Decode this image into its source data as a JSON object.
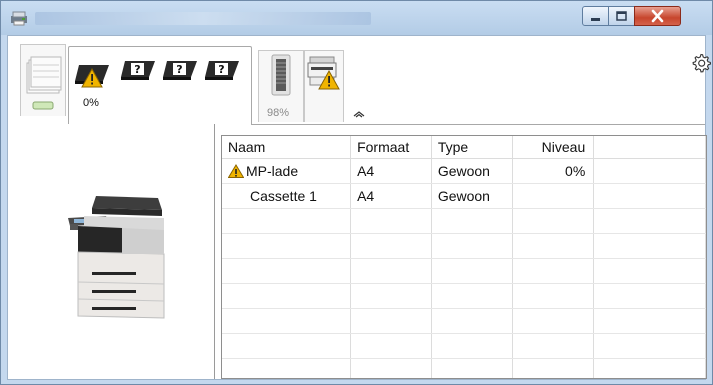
{
  "window": {
    "title": "",
    "controls": {
      "minimize": "minimize",
      "maximize": "maximize",
      "close": "close"
    }
  },
  "status_strip": {
    "toner_level": "0%",
    "waste_toner_level": "98%",
    "icons": [
      "paper-stack-icon",
      "toner-warning-icon",
      "toner-unknown-icon",
      "toner-unknown-icon",
      "toner-unknown-icon",
      "waste-toner-icon",
      "printer-warning-icon",
      "collapse-icon",
      "gear-icon"
    ]
  },
  "colors": {
    "accent": "#f0b400",
    "frame": "#c4d8ee",
    "close": "#c7462d"
  },
  "table": {
    "columns": [
      "Naam",
      "Formaat",
      "Type",
      "Niveau"
    ],
    "rows": [
      {
        "name": "MP-lade",
        "format": "A4",
        "type": "Gewoon",
        "level": "0%",
        "warning": true
      },
      {
        "name": "Cassette 1",
        "format": "A4",
        "type": "Gewoon",
        "level": "",
        "warning": false
      }
    ]
  }
}
